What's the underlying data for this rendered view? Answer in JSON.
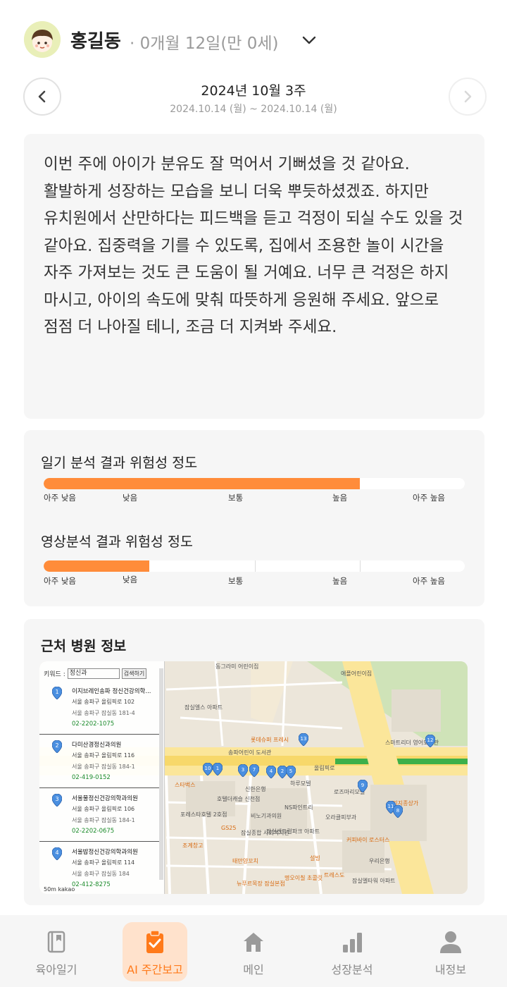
{
  "profile": {
    "name": "홍길동",
    "age": "· 0개월 12일(만 0세)",
    "avatar_icon": "child-avatar-icon",
    "dropdown_icon": "chevron-down-icon"
  },
  "week": {
    "title": "2024년 10월 3주",
    "range": "2024.10.14 (월) ~ 2024.10.14 (월)",
    "prev_icon": "chevron-left-icon",
    "next_icon": "chevron-right-icon"
  },
  "summary": {
    "text": "이번 주에 아이가 분유도 잘 먹어서 기뻐셨을 것 같아요. 활발하게 성장하는 모습을 보니 더욱 뿌듯하셨겠죠. 하지만 유치원에서 산만하다는 피드백을 듣고 걱정이 되실 수도 있을 것 같아요. 집중력을 기를 수 있도록, 집에서 조용한 놀이 시간을 자주 가져보는 것도 큰 도움이 될 거예요. 너무 큰 걱정은 하지 마시고, 아이의 속도에 맞춰 따뜻하게 응원해 주세요. 앞으로 점점 더 나아질 테니, 조금 더 지켜봐 주세요."
  },
  "risk": {
    "accent_color": "#ff8c3a",
    "diary": {
      "title": "일기 분석 결과 위험성 정도",
      "level_fraction": 0.75
    },
    "video": {
      "title": "영상분석 결과 위험성 정도",
      "level_fraction": 0.25
    },
    "scale_labels": [
      "아주 낮음",
      "낮음",
      "보통",
      "높음",
      "아주 높음"
    ]
  },
  "hospital": {
    "title": "근처 병원 정보",
    "search": {
      "label": "키워드 :",
      "value": "정신과",
      "button": "검색하기"
    },
    "items": [
      {
        "num": "1",
        "name": "이지브레인송파 정신건강의학...",
        "addr": "서울 송파구 올림픽로 102",
        "old": "서울 송파구 잠실동 181-4",
        "tel": "02-2202-1075"
      },
      {
        "num": "2",
        "name": "다미산경정신과의원",
        "addr": "서울 송파구 올림픽로 116",
        "old": "서울 송파구 잠실동 184-1",
        "tel": "02-419-0152"
      },
      {
        "num": "3",
        "name": "서울물정신건강의학과의원",
        "addr": "서울 송파구 올림픽로 106",
        "old": "서울 송파구 잠실동 184-1",
        "tel": "02-2202-0675"
      },
      {
        "num": "4",
        "name": "서울밥정신건강의학과의원",
        "addr": "서울 송파구 올림픽로 114",
        "old": "서울 송파구 잠실동 184",
        "tel": "02-412-8275"
      }
    ],
    "scale": "50m",
    "map_brand": "kakao",
    "map_labels": [
      "올림픽로",
      "잠실엘스 아파트",
      "송파어린이 도서관",
      "잠실종합 사회복지관",
      "잠실센트럴파크 아파트",
      "잠실엘타워 아파트",
      "스마트리더 영어도서관",
      "동그라미 어린이집",
      "애플어린이집",
      "포레스타호텔 2호점",
      "비노기과의원",
      "오라클피부과",
      "우리은행",
      "신한은행",
      "하루모텔",
      "로즈마리모텔",
      "NS파인트리",
      "호텔더캐슬 신천점"
    ],
    "map_pois": [
      "스타벅스",
      "조계창고",
      "GS25",
      "태만양꼬치",
      "설빙",
      "트레스도",
      "뉴푸르목장 잠실본점",
      "명오이칠 초콜릿",
      "커피바이 로스터스",
      "트리지종상가",
      "롯데슈퍼 프레시"
    ],
    "pin_numbers": [
      "13",
      "12",
      "10",
      "1",
      "3",
      "7",
      "4",
      "2",
      "5",
      "9",
      "11",
      "8"
    ]
  },
  "bottom_nav": [
    {
      "label": "육아일기",
      "icon": "diary-icon",
      "active": false
    },
    {
      "label": "AI 주간보고",
      "icon": "clipboard-check-icon",
      "active": true
    },
    {
      "label": "메인",
      "icon": "home-icon",
      "active": false
    },
    {
      "label": "성장분석",
      "icon": "bar-chart-icon",
      "active": false
    },
    {
      "label": "내정보",
      "icon": "person-icon",
      "active": false
    }
  ]
}
